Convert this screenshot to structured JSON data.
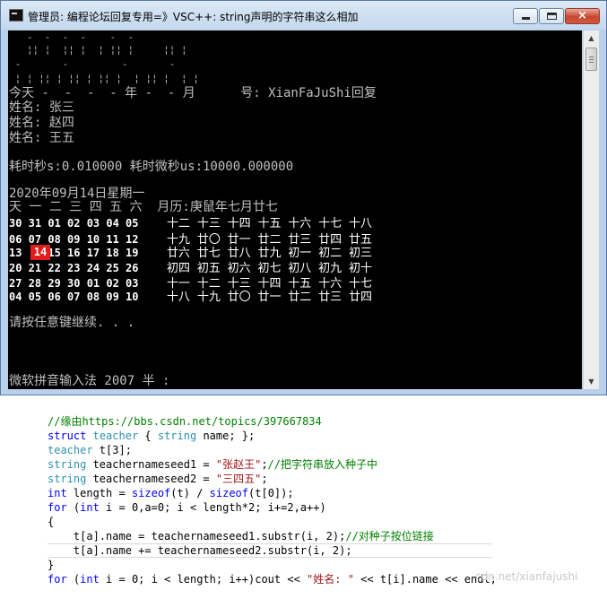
{
  "window": {
    "title": "管理员:  编程论坛回复专用=》VSC++:  string声明的字符串这么相加",
    "buttons": {
      "minimize": "minimize",
      "maximize": "maximize",
      "close": "×"
    }
  },
  "console": {
    "banner": [
      "   -  -  -  -    -  -",
      "   ¦¦ ¦  ¦¦ ¦  ¦ ¦¦ ¦     ¦¦ ¦",
      " -       -         -       -",
      " ¦ ¦ ¦¦ ¦ ¦¦ ¦ ¦¦ ¦  ¦ ¦¦ ¦  ¦ ¦"
    ],
    "date_line": "今天 -  -  -  - 年 -  - 月      号: XianFaJuShi回复",
    "names": [
      "姓名: 张三",
      "姓名: 赵四",
      "姓名: 王五"
    ],
    "timing": "耗时秒s:0.010000 耗时微秒us:10000.000000",
    "today": "2020年09月14日星期一",
    "weekday_header": "天 一 二 三 四 五 六  月历:庚鼠年七月廿七",
    "calendar_rows": [
      {
        "nums": "30 31 01 02 03 04 05",
        "lunar": "十二 十三 十四 十五 十六 十七 十八"
      },
      {
        "nums": "06 07 08 09 10 11 12",
        "lunar": "十九 廿〇 廿一 廿二 廿三 廿四 廿五"
      },
      {
        "nums": "13    15 16 17 18 19",
        "lunar": "廿六 廿七 廿八 廿九 初一 初二 初三"
      },
      {
        "nums": "20 21 22 23 24 25 26",
        "lunar": "初四 初五 初六 初七 初八 初九 初十"
      },
      {
        "nums": "27 28 29 30 01 02 03",
        "lunar": "十一 十二 十三 十四 十五 十六 十七"
      },
      {
        "nums": "04 05 06 07 08 09 10",
        "lunar": "十八 十九 廿〇 廿一 廿二 廿三 廿四"
      }
    ],
    "highlight_day": "14",
    "prompt": "请按任意键继续. . .",
    "ime_status": "微软拼音输入法 2007 半 :"
  },
  "code": {
    "comment_line": "//缘由https://bbs.csdn.net/topics/397667834",
    "struct_line": {
      "kw": "struct",
      "name": "teacher",
      "open": " { ",
      "type": "string",
      "rest": " name; };"
    },
    "array_line": {
      "type": "teacher",
      "rest": " t[3];"
    },
    "seed1_line": {
      "type": "string",
      "rest": " teachernameseed1 = ",
      "str": "\"张赵王\"",
      "tail": ";",
      "comment": "//把字符串放入种子中"
    },
    "seed2_line": {
      "type": "string",
      "rest": " teachernameseed2 = ",
      "str": "\"三四五\"",
      "tail": ";"
    },
    "length_line": {
      "type": "int",
      "a": " length = ",
      "sizeof1": "sizeof",
      "b": "(t) / ",
      "sizeof2": "sizeof",
      "c": "(t[0]);"
    },
    "for1_line": {
      "kw": "for",
      "a": " (",
      "type": "int",
      "b": " i = 0,a=0; i < length*2; i+=2,a++)"
    },
    "open_brace": "{",
    "body1": {
      "code": "    t[a].name = teachernameseed1.substr(i, 2);",
      "comment": "//对种子按位链接"
    },
    "body2": "    t[a].name += teachernameseed2.substr(i, 2);",
    "close_brace": "}",
    "for2_line": {
      "kw": "for",
      "a": " (",
      "type": "int",
      "b": " i = 0; i < length; i++)cout << ",
      "str": "\"姓名: \"",
      "c": " << t[i].name << endl;"
    },
    "watermark": "cdn.net/xianfajushi"
  }
}
